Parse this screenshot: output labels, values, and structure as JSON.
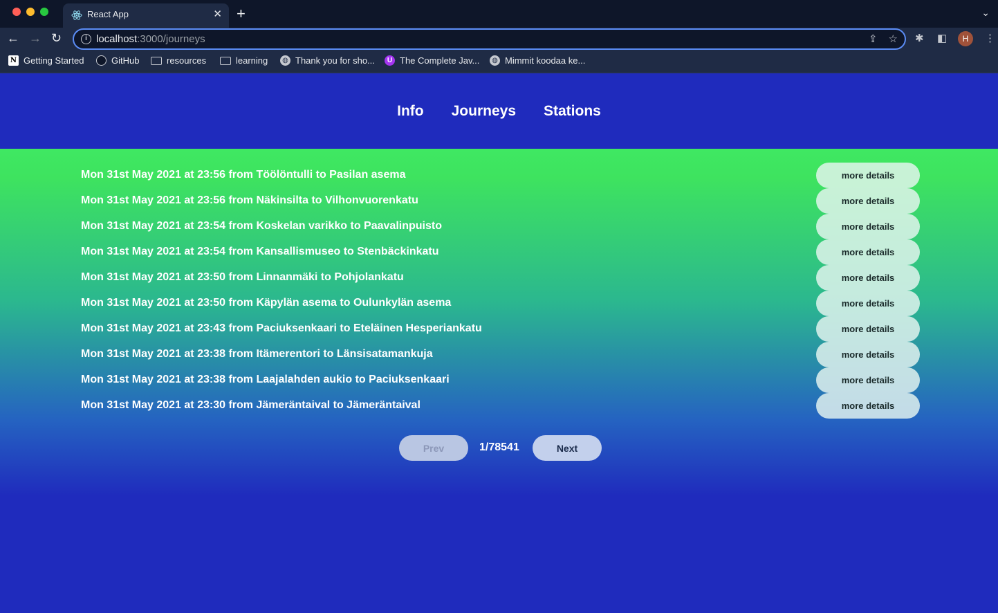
{
  "browser": {
    "tab_title": "React App",
    "tab_close": "✕",
    "new_tab": "+",
    "url_host": "localhost",
    "url_path": ":3000/journeys",
    "avatar_letter": "H",
    "bookmarks": [
      {
        "label": "Getting Started",
        "icon": "notion-icon"
      },
      {
        "label": "GitHub",
        "icon": "github-icon"
      },
      {
        "label": "resources",
        "icon": "folder-icon"
      },
      {
        "label": "learning",
        "icon": "folder-icon"
      },
      {
        "label": "Thank you for sho...",
        "icon": "globe-icon"
      },
      {
        "label": "The Complete Jav...",
        "icon": "udemy-icon"
      },
      {
        "label": "Mimmit koodaa ke...",
        "icon": "globe-icon"
      }
    ]
  },
  "nav": {
    "info": "Info",
    "journeys": "Journeys",
    "stations": "Stations"
  },
  "journeys": [
    {
      "text": "Mon 31st May 2021 at 23:56 from Töölöntulli to Pasilan asema",
      "button": "more details"
    },
    {
      "text": "Mon 31st May 2021 at 23:56 from Näkinsilta to Vilhonvuorenkatu",
      "button": "more details"
    },
    {
      "text": "Mon 31st May 2021 at 23:54 from Koskelan varikko to Paavalinpuisto",
      "button": "more details"
    },
    {
      "text": "Mon 31st May 2021 at 23:54 from Kansallismuseo to Stenbäckinkatu",
      "button": "more details"
    },
    {
      "text": "Mon 31st May 2021 at 23:50 from Linnanmäki to Pohjolankatu",
      "button": "more details"
    },
    {
      "text": "Mon 31st May 2021 at 23:50 from Käpylän asema to Oulunkylän asema",
      "button": "more details"
    },
    {
      "text": "Mon 31st May 2021 at 23:43 from Paciuksenkaari to Eteläinen Hesperiankatu",
      "button": "more details"
    },
    {
      "text": "Mon 31st May 2021 at 23:38 from Itämerentori to Länsisatamankuja",
      "button": "more details"
    },
    {
      "text": "Mon 31st May 2021 at 23:38 from Laajalahden aukio to Paciuksenkaari",
      "button": "more details"
    },
    {
      "text": "Mon 31st May 2021 at 23:30 from Jämeräntaival to Jämeräntaival",
      "button": "more details"
    }
  ],
  "pagination": {
    "prev": "Prev",
    "indicator": "1/78541",
    "next": "Next"
  }
}
